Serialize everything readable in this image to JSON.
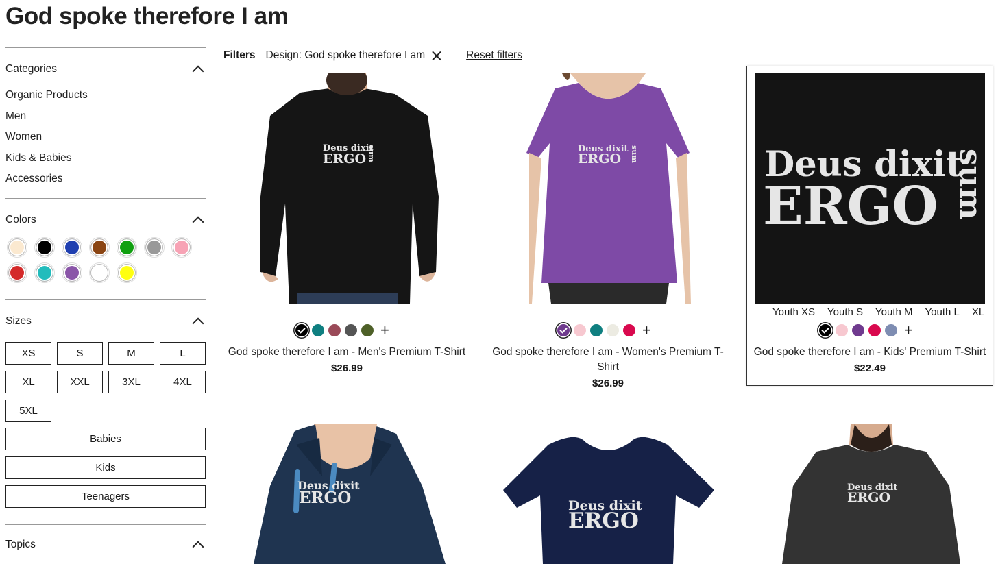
{
  "page": {
    "title": "God spoke therefore I am"
  },
  "sidebar": {
    "categories": {
      "title": "Categories",
      "items": [
        "Organic Products",
        "Men",
        "Women",
        "Kids & Babies",
        "Accessories"
      ]
    },
    "colors": {
      "title": "Colors",
      "swatches": [
        "#fbe9d0",
        "#000000",
        "#1f3fb0",
        "#8b4513",
        "#10a010",
        "#999999",
        "#f7a3b5",
        "#d42a2a",
        "#22bcbc",
        "#8a55a8",
        "#ffffff",
        "#ffff10"
      ]
    },
    "sizes": {
      "title": "Sizes",
      "grid": [
        "XS",
        "S",
        "M",
        "L",
        "XL",
        "XXL",
        "3XL",
        "4XL",
        "5XL"
      ],
      "wide": [
        "Babies",
        "Kids",
        "Teenagers"
      ]
    },
    "topics": {
      "title": "Topics"
    }
  },
  "filters": {
    "label": "Filters",
    "active": "Design: God spoke therefore I am",
    "reset": "Reset filters"
  },
  "design": {
    "line1": "Deus dixit",
    "line2": "ERGO",
    "side": "sum"
  },
  "products": [
    {
      "name": "God spoke therefore I am - Men's Premium T-Shirt",
      "price": "$26.99",
      "colors": [
        "#000000",
        "#0f7f80",
        "#9a4a58",
        "#555555",
        "#4e6028"
      ]
    },
    {
      "name": "God spoke therefore I am - Women's Premium T-Shirt",
      "price": "$26.99",
      "colors": [
        "#6f3a8e",
        "#f7c8d0",
        "#0f7f80",
        "#ecebe2",
        "#d9094e"
      ]
    },
    {
      "name": "God spoke therefore I am - Kids' Premium T-Shirt",
      "price": "$22.49",
      "colors": [
        "#000000",
        "#f7c8d0",
        "#6f3a8e",
        "#d9094e",
        "#7e8db2"
      ],
      "sizes": [
        "Youth XS",
        "Youth S",
        "Youth M",
        "Youth L",
        "XL"
      ]
    }
  ]
}
